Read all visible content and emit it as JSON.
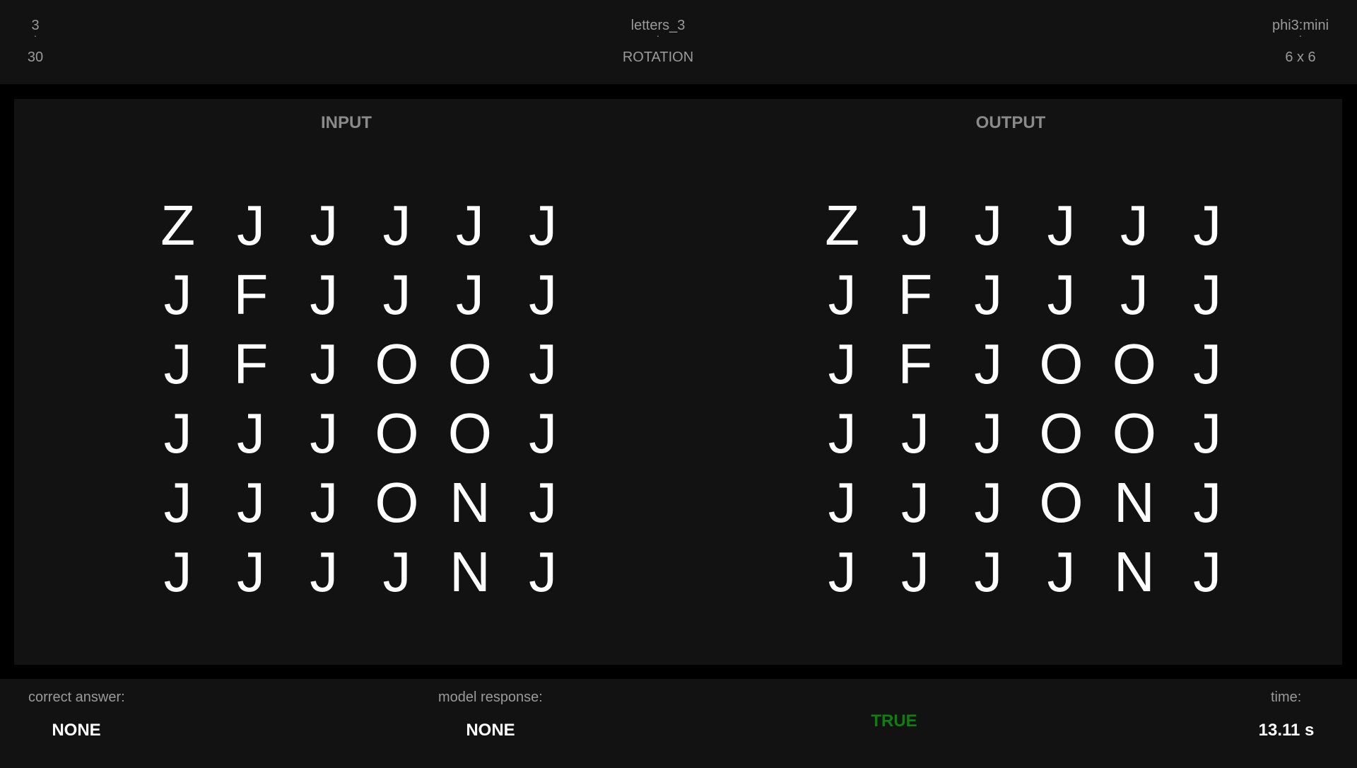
{
  "header": {
    "left": {
      "top": "3",
      "bottom": "30"
    },
    "center": {
      "top": "letters_3",
      "bottom": "ROTATION"
    },
    "right": {
      "top": "phi3:mini",
      "bottom": "6 x 6"
    },
    "separator": "·"
  },
  "panel": {
    "input_title": "INPUT",
    "output_title": "OUTPUT",
    "input_grid": [
      [
        "Z",
        "J",
        "J",
        "J",
        "J",
        "J"
      ],
      [
        "J",
        "F",
        "J",
        "J",
        "J",
        "J"
      ],
      [
        "J",
        "F",
        "J",
        "O",
        "O",
        "J"
      ],
      [
        "J",
        "J",
        "J",
        "O",
        "O",
        "J"
      ],
      [
        "J",
        "J",
        "J",
        "O",
        "N",
        "J"
      ],
      [
        "J",
        "J",
        "J",
        "J",
        "N",
        "J"
      ]
    ],
    "output_grid": [
      [
        "Z",
        "J",
        "J",
        "J",
        "J",
        "J"
      ],
      [
        "J",
        "F",
        "J",
        "J",
        "J",
        "J"
      ],
      [
        "J",
        "F",
        "J",
        "O",
        "O",
        "J"
      ],
      [
        "J",
        "J",
        "J",
        "O",
        "O",
        "J"
      ],
      [
        "J",
        "J",
        "J",
        "O",
        "N",
        "J"
      ],
      [
        "J",
        "J",
        "J",
        "J",
        "N",
        "J"
      ]
    ]
  },
  "footer": {
    "correct_label": "correct answer:",
    "correct_value": "NONE",
    "model_label": "model response:",
    "model_value": "NONE",
    "result": "TRUE",
    "result_color": "#0f7d0f",
    "time_label": "time:",
    "time_value": "13.11 s"
  }
}
